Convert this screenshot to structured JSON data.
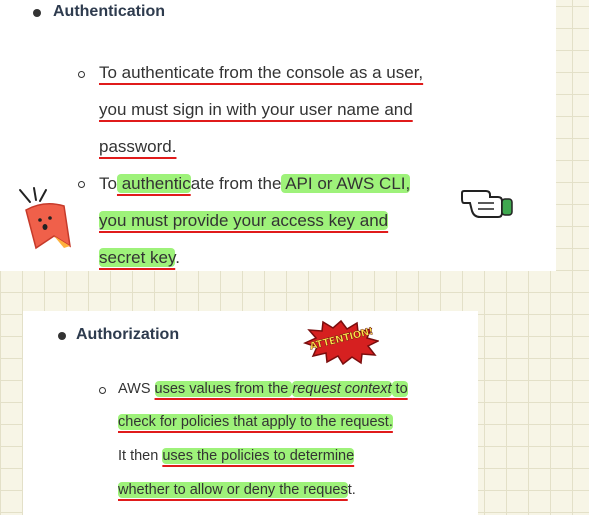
{
  "auth": {
    "heading": "Authentication",
    "b1": {
      "l1": "To authenticate from the console as a user,",
      "l2": "you must sign in with your user name and",
      "l3": "password."
    },
    "b2": {
      "l1a": "To",
      "l1b": " authentic",
      "l1c": "ate from the",
      "l1d": " API or AWS CLI,",
      "l2": "you must provide your access key and",
      "l3a": "secret key",
      "l3b": "."
    }
  },
  "authz": {
    "heading": "Authorization",
    "b1": {
      "l1a": "AWS ",
      "l1b": "uses values from the ",
      "l1c": "request context",
      "l1d": " to",
      "l2": "check for policies that apply to the request.",
      "l3a": "It then ",
      "l3b": "uses the policies to determine",
      "l4a": "whether to allow or deny the reques",
      "l4b": "t."
    }
  },
  "stickers": {
    "attention_text": "ATTENTION!",
    "colors": {
      "highlight": "#9ef27a",
      "underline": "#e01b1b",
      "attention": "#d62020"
    }
  }
}
